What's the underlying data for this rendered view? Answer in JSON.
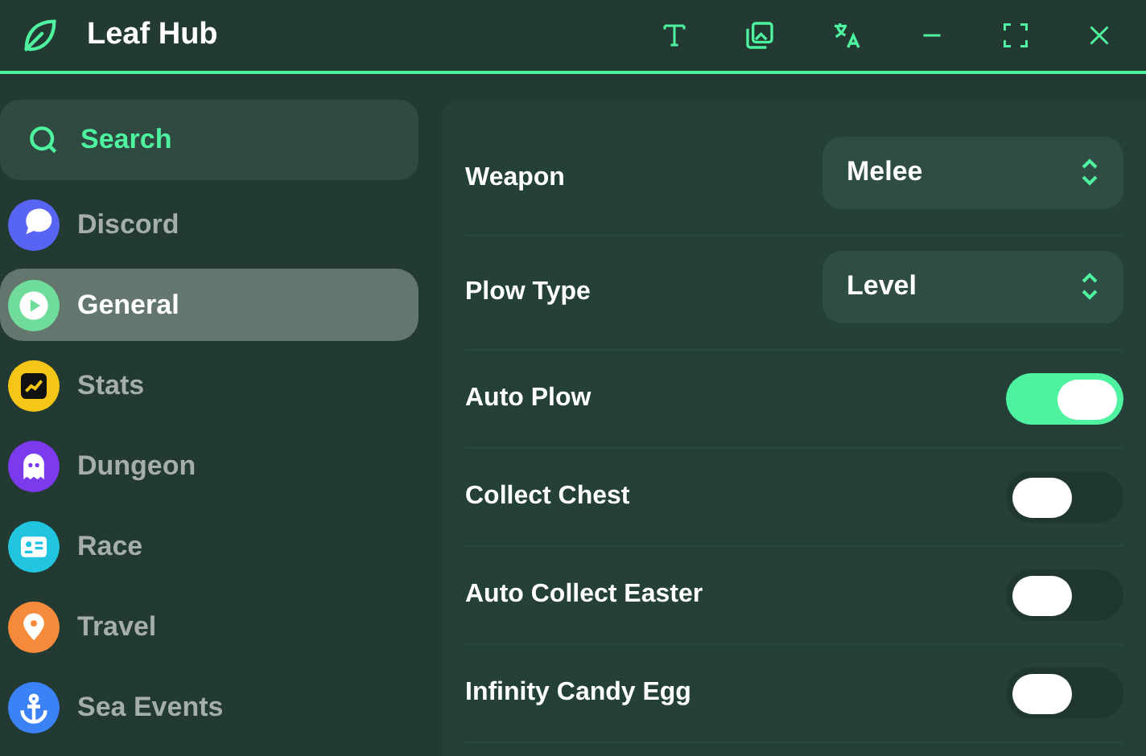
{
  "window": {
    "title": "Leaf Hub"
  },
  "search": {
    "placeholder": "Search"
  },
  "sidebar": {
    "items": [
      {
        "label": "Discord",
        "selected": false,
        "color": "#5865f2",
        "kind": "chat"
      },
      {
        "label": "General",
        "selected": true,
        "color": "#6fdc9c",
        "kind": "play"
      },
      {
        "label": "Stats",
        "selected": false,
        "color": "#f5c518",
        "kind": "chart"
      },
      {
        "label": "Dungeon",
        "selected": false,
        "color": "#7c3aed",
        "kind": "ghost"
      },
      {
        "label": "Race",
        "selected": false,
        "color": "#22c5e0",
        "kind": "card"
      },
      {
        "label": "Travel",
        "selected": false,
        "color": "#f58a3a",
        "kind": "pin"
      },
      {
        "label": "Sea Events",
        "selected": false,
        "color": "#3b82f6",
        "kind": "anchor"
      }
    ]
  },
  "settings": [
    {
      "kind": "dropdown",
      "label": "Weapon",
      "value": "Melee"
    },
    {
      "kind": "dropdown",
      "label": "Plow Type",
      "value": "Level"
    },
    {
      "kind": "toggle",
      "label": "Auto Plow",
      "on": true
    },
    {
      "kind": "toggle",
      "label": "Collect Chest",
      "on": false
    },
    {
      "kind": "toggle",
      "label": "Auto Collect Easter",
      "on": false
    },
    {
      "kind": "toggle",
      "label": "Infinity Candy Egg",
      "on": false
    }
  ]
}
